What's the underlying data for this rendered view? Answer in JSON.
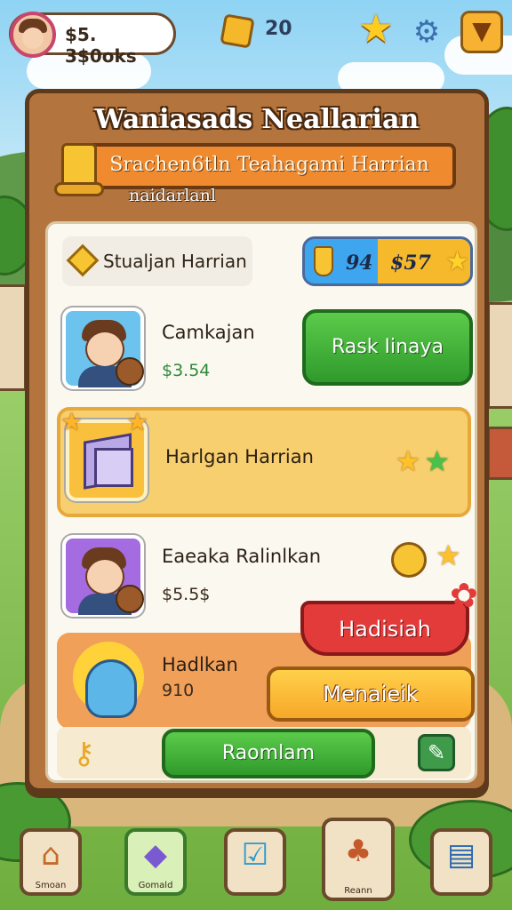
{
  "top_bar": {
    "balance_text": "$5. 3$0oks",
    "currency_count": "20"
  },
  "panel": {
    "title": "Waniasads Neallarian",
    "ribbon_text": "Srachen6tln Teahagami Harrian",
    "ribbon_subtext": "naidarlanl"
  },
  "summary": {
    "label": "Stualjan Harrian",
    "stat_left": "94",
    "stat_right": "$57"
  },
  "tasks": [
    {
      "title": "Camkajan",
      "reward": "$3.54",
      "button_label": "Rask Iinaya"
    },
    {
      "title": "Harlgan Harrian"
    },
    {
      "title": "Eaeaka Ralinlkan",
      "reward": "$5.5$"
    },
    {
      "title": "Hadlkan",
      "reward": "910",
      "badge_label": "Hadisiah",
      "button_label": "Menaieik"
    }
  ],
  "footer": {
    "main_button_label": "Raomlam"
  },
  "bottom_nav": [
    {
      "label": "Smoan",
      "icon": "house-icon"
    },
    {
      "label": "Gomald",
      "icon": "box-icon"
    },
    {
      "label": "",
      "icon": "check-box-icon"
    },
    {
      "label": "Reann",
      "icon": "rewards-cart-icon"
    },
    {
      "label": "",
      "icon": "book-icon"
    }
  ]
}
